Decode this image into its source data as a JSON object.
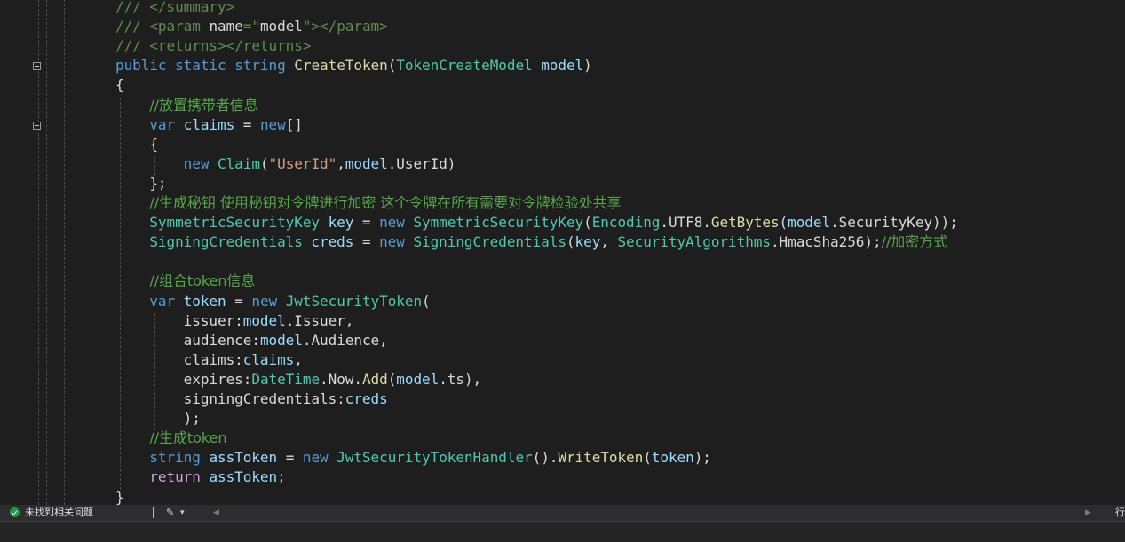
{
  "editor": {
    "lines": [
      [
        {
          "t": "/// ",
          "c": "xd"
        },
        {
          "t": "</summary>",
          "c": "xd"
        }
      ],
      [
        {
          "t": "/// ",
          "c": "xd"
        },
        {
          "t": "<param ",
          "c": "xd"
        },
        {
          "t": "name",
          "c": "id"
        },
        {
          "t": "=\"",
          "c": "xd"
        },
        {
          "t": "model",
          "c": "id"
        },
        {
          "t": "\"></param>",
          "c": "xd"
        }
      ],
      [
        {
          "t": "/// ",
          "c": "xd"
        },
        {
          "t": "<returns></returns>",
          "c": "xd"
        }
      ],
      [
        {
          "t": "public ",
          "c": "kw"
        },
        {
          "t": "static ",
          "c": "kw"
        },
        {
          "t": "string ",
          "c": "kw"
        },
        {
          "t": "CreateToken",
          "c": "fn"
        },
        {
          "t": "(",
          "c": "id"
        },
        {
          "t": "TokenCreateModel ",
          "c": "ty"
        },
        {
          "t": "model",
          "c": "pm"
        },
        {
          "t": ")",
          "c": "id"
        }
      ],
      [
        {
          "t": "{",
          "c": "id"
        }
      ],
      [
        {
          "t": "    ",
          "c": "id"
        },
        {
          "t": "//放置携带者信息",
          "c": "cm"
        }
      ],
      [
        {
          "t": "    ",
          "c": "id"
        },
        {
          "t": "var ",
          "c": "kw"
        },
        {
          "t": "claims",
          "c": "var"
        },
        {
          "t": " = ",
          "c": "id"
        },
        {
          "t": "new",
          "c": "kw"
        },
        {
          "t": "[]",
          "c": "id"
        }
      ],
      [
        {
          "t": "    {",
          "c": "id"
        }
      ],
      [
        {
          "t": "        ",
          "c": "id"
        },
        {
          "t": "new ",
          "c": "kw"
        },
        {
          "t": "Claim",
          "c": "ty"
        },
        {
          "t": "(",
          "c": "id"
        },
        {
          "t": "\"UserId\"",
          "c": "str"
        },
        {
          "t": ",",
          "c": "id"
        },
        {
          "t": "model",
          "c": "pm"
        },
        {
          "t": ".UserId)",
          "c": "id"
        }
      ],
      [
        {
          "t": "    };",
          "c": "id"
        }
      ],
      [
        {
          "t": "    ",
          "c": "id"
        },
        {
          "t": "//生成秘钥 使用秘钥对令牌进行加密 这个令牌在所有需要对令牌检验处共享",
          "c": "cm"
        }
      ],
      [
        {
          "t": "    ",
          "c": "id"
        },
        {
          "t": "SymmetricSecurityKey ",
          "c": "ty"
        },
        {
          "t": "key",
          "c": "var"
        },
        {
          "t": " = ",
          "c": "id"
        },
        {
          "t": "new ",
          "c": "kw"
        },
        {
          "t": "SymmetricSecurityKey",
          "c": "ty"
        },
        {
          "t": "(",
          "c": "id"
        },
        {
          "t": "Encoding",
          "c": "ty"
        },
        {
          "t": ".UTF8.",
          "c": "id"
        },
        {
          "t": "GetBytes",
          "c": "fn"
        },
        {
          "t": "(",
          "c": "id"
        },
        {
          "t": "model",
          "c": "pm"
        },
        {
          "t": ".SecurityKey));",
          "c": "id"
        }
      ],
      [
        {
          "t": "    ",
          "c": "id"
        },
        {
          "t": "SigningCredentials ",
          "c": "ty"
        },
        {
          "t": "creds",
          "c": "var"
        },
        {
          "t": " = ",
          "c": "id"
        },
        {
          "t": "new ",
          "c": "kw"
        },
        {
          "t": "SigningCredentials",
          "c": "ty"
        },
        {
          "t": "(",
          "c": "id"
        },
        {
          "t": "key",
          "c": "var"
        },
        {
          "t": ", ",
          "c": "id"
        },
        {
          "t": "SecurityAlgorithms",
          "c": "ty"
        },
        {
          "t": ".HmacSha256);",
          "c": "id"
        },
        {
          "t": "//加密方式",
          "c": "cm"
        }
      ],
      [
        {
          "t": "",
          "c": "id"
        }
      ],
      [
        {
          "t": "    ",
          "c": "id"
        },
        {
          "t": "//组合token信息",
          "c": "cm"
        }
      ],
      [
        {
          "t": "    ",
          "c": "id"
        },
        {
          "t": "var ",
          "c": "kw"
        },
        {
          "t": "token",
          "c": "var"
        },
        {
          "t": " = ",
          "c": "id"
        },
        {
          "t": "new ",
          "c": "kw"
        },
        {
          "t": "JwtSecurityToken",
          "c": "ty"
        },
        {
          "t": "(",
          "c": "id"
        }
      ],
      [
        {
          "t": "        ",
          "c": "id"
        },
        {
          "t": "issuer",
          "c": "id"
        },
        {
          "t": ":",
          "c": "id"
        },
        {
          "t": "model",
          "c": "pm"
        },
        {
          "t": ".Issuer,",
          "c": "id"
        }
      ],
      [
        {
          "t": "        ",
          "c": "id"
        },
        {
          "t": "audience",
          "c": "id"
        },
        {
          "t": ":",
          "c": "id"
        },
        {
          "t": "model",
          "c": "pm"
        },
        {
          "t": ".Audience,",
          "c": "id"
        }
      ],
      [
        {
          "t": "        ",
          "c": "id"
        },
        {
          "t": "claims",
          "c": "id"
        },
        {
          "t": ":",
          "c": "id"
        },
        {
          "t": "claims",
          "c": "var"
        },
        {
          "t": ",",
          "c": "id"
        }
      ],
      [
        {
          "t": "        ",
          "c": "id"
        },
        {
          "t": "expires",
          "c": "id"
        },
        {
          "t": ":",
          "c": "id"
        },
        {
          "t": "DateTime",
          "c": "ty"
        },
        {
          "t": ".Now.",
          "c": "id"
        },
        {
          "t": "Add",
          "c": "fn"
        },
        {
          "t": "(",
          "c": "id"
        },
        {
          "t": "model",
          "c": "pm"
        },
        {
          "t": ".ts),",
          "c": "id"
        }
      ],
      [
        {
          "t": "        ",
          "c": "id"
        },
        {
          "t": "signingCredentials",
          "c": "id"
        },
        {
          "t": ":",
          "c": "id"
        },
        {
          "t": "creds",
          "c": "var"
        }
      ],
      [
        {
          "t": "        );",
          "c": "id"
        }
      ],
      [
        {
          "t": "    ",
          "c": "id"
        },
        {
          "t": "//生成token",
          "c": "cm"
        }
      ],
      [
        {
          "t": "    ",
          "c": "id"
        },
        {
          "t": "string ",
          "c": "kw"
        },
        {
          "t": "assToken",
          "c": "var"
        },
        {
          "t": " = ",
          "c": "id"
        },
        {
          "t": "new ",
          "c": "kw"
        },
        {
          "t": "JwtSecurityTokenHandler",
          "c": "ty"
        },
        {
          "t": "().",
          "c": "id"
        },
        {
          "t": "WriteToken",
          "c": "fn"
        },
        {
          "t": "(",
          "c": "id"
        },
        {
          "t": "token",
          "c": "var"
        },
        {
          "t": ");",
          "c": "id"
        }
      ],
      [
        {
          "t": "    ",
          "c": "id"
        },
        {
          "t": "return ",
          "c": "kw2"
        },
        {
          "t": "assToken",
          "c": "var"
        },
        {
          "t": ";",
          "c": "id"
        }
      ],
      [
        {
          "t": "}",
          "c": "id"
        }
      ]
    ],
    "fold_lines": [
      3,
      6
    ]
  },
  "statusbar": {
    "issues_text": "未找到相关问题",
    "brush_icon": "brush-icon",
    "dropdown_glyph": "▾",
    "scroll_left_glyph": "◀",
    "scroll_right_glyph": "▶",
    "line_label": "行"
  },
  "colors": {
    "keyword": "#569cd6",
    "control_keyword": "#d8a0df",
    "type": "#4ec9b0",
    "method": "#dcdcaa",
    "string": "#d69d85",
    "comment": "#57a64a",
    "background": "#1e1e1e"
  }
}
